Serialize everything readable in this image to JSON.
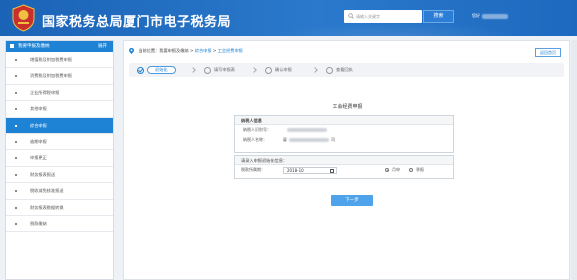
{
  "header": {
    "title": "国家税务总局厦门市电子税务局",
    "search_placeholder": "请输入关键字",
    "search_button": "搜索",
    "user_prefix": "您好",
    "emblem_icon": "tax-emblem-icon"
  },
  "sidebar": {
    "title": "我要申报及缴纳",
    "collapse_label": "展开",
    "items": [
      {
        "label": "增值税及附加税费申报"
      },
      {
        "label": "消费税及附加税费申报"
      },
      {
        "label": "企业所得税申报"
      },
      {
        "label": "其他申报"
      },
      {
        "label": "综合申报"
      },
      {
        "label": "逾期申报"
      },
      {
        "label": "申报更正"
      },
      {
        "label": "财务报表报送"
      },
      {
        "label": "税收减免核准报送"
      },
      {
        "label": "财务报表数据转换"
      },
      {
        "label": "税款缴纳"
      }
    ],
    "active_index": 4
  },
  "breadcrumb": {
    "prefix": "当前位置：",
    "path1": "我要申报及缴纳",
    "sep": " > ",
    "path2": "综合申报",
    "path3": "工会经费申报"
  },
  "return_button": "返回首页",
  "steps": [
    {
      "label": "初始化",
      "active": true
    },
    {
      "label": "填写申报表",
      "active": false
    },
    {
      "label": "确认申报",
      "active": false
    },
    {
      "label": "查看回执",
      "active": false
    }
  ],
  "form": {
    "title": "工会经费申报",
    "taxpayer_section": "纳税人信息",
    "taxpayer_id_label": "纳税人识别号：",
    "taxpayer_name_label": "纳税人名称：",
    "taxpayer_name_suffix": "司",
    "taxpayer_name_prefix": "厦",
    "init_section": "请录入申报初始化信息：",
    "period_label": "税款所属期：",
    "period_value": "2018-10",
    "option_monthly": "月申",
    "option_quarterly": "季报",
    "selected_option": "月申",
    "next_button": "下一步"
  },
  "colors": {
    "brand_blue": "#1f83d5",
    "header_blue": "#1b63b6",
    "button_blue": "#4ea3ea"
  }
}
